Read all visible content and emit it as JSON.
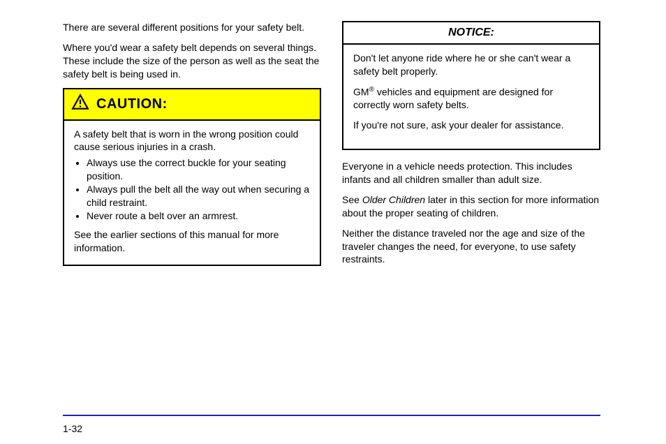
{
  "left": {
    "p1": "There are several different positions for your safety belt.",
    "p2": "Where you'd wear a safety belt depends on several things. These include the size of the person as well as the seat the safety belt is being used in."
  },
  "caution": {
    "title": "CAUTION:",
    "lead": "A safety belt that is worn in the wrong position could cause serious injuries in a crash.",
    "bullets": [
      "Always use the correct buckle for your seating position.",
      "Always pull the belt all the way out when securing a child restraint.",
      "Never route a belt over an armrest."
    ],
    "tail": "See the earlier sections of this manual for more information."
  },
  "notice": {
    "title": "NOTICE:",
    "p1": "Don't let anyone ride where he or she can't wear a safety belt properly.",
    "brand": "GM",
    "p2_after": " vehicles and equipment are designed for correctly worn safety belts.",
    "p3": "If you're not sure, ask your dealer for assistance."
  },
  "rightLower": {
    "p1": "Everyone in a vehicle needs protection. This includes infants and all children smaller than adult size.",
    "p2_pre": "See ",
    "p2_italic": "Older Children",
    "p2_post": " later in this section for more information about the proper seating of children.",
    "p3": "Neither the distance traveled nor the age and size of the traveler changes the need, for everyone, to use safety restraints."
  },
  "pageNumber": "1-32"
}
